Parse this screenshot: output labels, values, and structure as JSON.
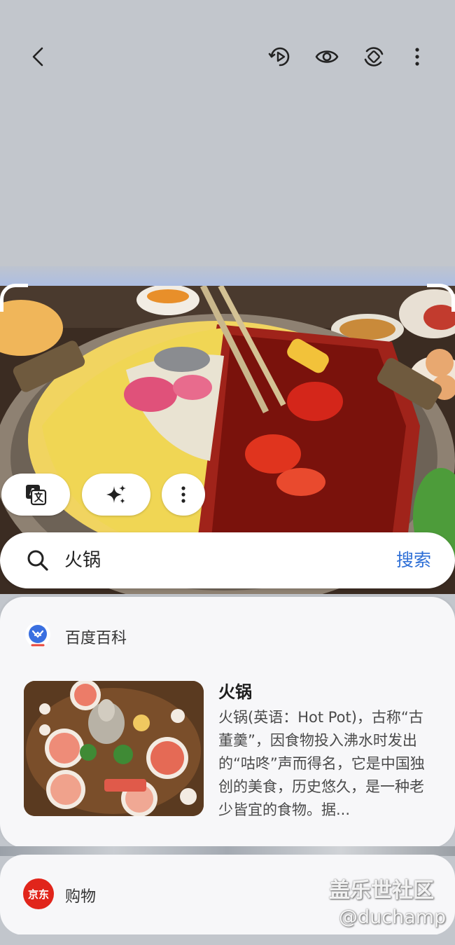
{
  "toolbar": {
    "back_icon": "chevron-left-icon",
    "actions": [
      "motion-photo-icon",
      "eye-icon",
      "rotate-icon",
      "more-vertical-icon"
    ]
  },
  "image_actions": [
    "translate-icon",
    "sparkle-ai-icon",
    "more-vertical-icon"
  ],
  "search": {
    "query": "火锅",
    "button_label": "搜索"
  },
  "result_card": {
    "source": "百度百科",
    "title": "火锅",
    "description": "火锅(英语：Hot Pot)，古称“古董羹”，因食物投入沸水时发出的“咕咚”声而得名，它是中国独创的美食，历史悠久，是一种老少皆宜的食物。据..."
  },
  "shopping_card": {
    "logo_text": "京东",
    "label": "购物"
  },
  "watermark": {
    "line1": "盖乐世社区",
    "line2": "@duchamp"
  },
  "colors": {
    "background": "#c2c6cc",
    "accent": "#2e6fd6",
    "jd_red": "#e1251b",
    "card": "#f7f7f9"
  }
}
